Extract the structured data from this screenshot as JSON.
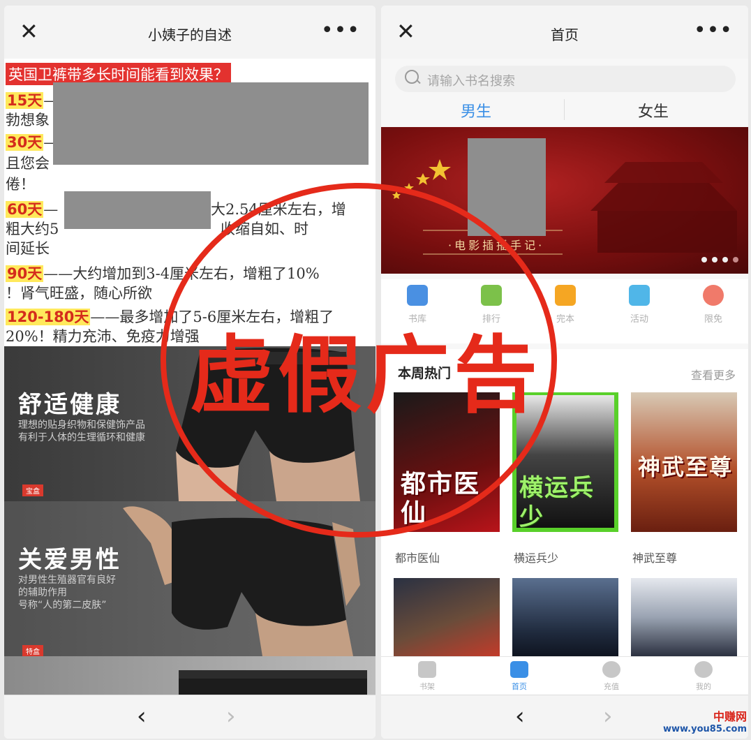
{
  "left_screen": {
    "title": "小姨子的自述",
    "close_icon": "close-icon",
    "more_icon": "more-icon",
    "article": {
      "headline": "英国卫裤带多长时间能看到效果？",
      "items": [
        {
          "day": "15天",
          "text": "—",
          "extra": "勃想象"
        },
        {
          "day": "30天",
          "text": "—",
          "extra": "且您会",
          "extra2": "倦！"
        },
        {
          "day": "60天",
          "text": "—",
          "tail": "大2.54厘米左右，增",
          "line2": "粗大约5",
          "line2b": "收缩自如、时",
          "line3": "间延长"
        },
        {
          "day": "90天",
          "text": "——大约增加到3-4厘米左右，增粗了10%",
          "line2": "！肾气旺盛，随心所欲"
        },
        {
          "day": "120-180天",
          "text": "——最多增加了5-6厘米左右，增粗了",
          "line2": "20%！精力充沛、免疫力增强"
        }
      ]
    },
    "ads": [
      {
        "heading": "舒适健康",
        "desc": [
          "理想的贴身织物和保健饰产品",
          "有利于人体的生理循环和健康"
        ],
        "tag": "宝盒"
      },
      {
        "heading": "关爱男性",
        "desc": [
          "对男性生殖器官有良好",
          "的辅助作用",
          "号称“人的第二皮肤”"
        ],
        "tag": "特盒"
      }
    ],
    "nav": {
      "back": "‹",
      "forward": "›"
    }
  },
  "right_screen": {
    "title": "首页",
    "search_placeholder": "请输入书名搜索",
    "gender_tabs": [
      "男生",
      "女生"
    ],
    "banner_caption": "·电影插播手记·",
    "banner_dots": 4,
    "categories": [
      {
        "label": "书库",
        "icon": "library-icon",
        "color": "#4a90e2"
      },
      {
        "label": "排行",
        "icon": "ranking-icon",
        "color": "#7cc14a"
      },
      {
        "label": "完本",
        "icon": "complete-icon",
        "color": "#f5a623"
      },
      {
        "label": "活动",
        "icon": "gift-icon",
        "color": "#50b6e8"
      },
      {
        "label": "限免",
        "icon": "clock-icon",
        "color": "#f07a6a"
      }
    ],
    "section_title": "本周热门",
    "section_more": "查看更多",
    "books": [
      {
        "name": "都市医仙",
        "cover_title": "都市医仙"
      },
      {
        "name": "横运兵少",
        "cover_title": "横运兵少"
      },
      {
        "name": "神武至尊",
        "cover_title": "神武至尊"
      }
    ],
    "tabbar": [
      {
        "label": "书架",
        "icon": "bookshelf-icon"
      },
      {
        "label": "首页",
        "icon": "home-icon"
      },
      {
        "label": "充值",
        "icon": "recharge-icon"
      },
      {
        "label": "我的",
        "icon": "profile-icon"
      }
    ],
    "nav": {
      "back": "‹",
      "forward": "›"
    }
  },
  "stamp": {
    "text": "虚假广告",
    "color": "#e52a1a"
  },
  "watermark": {
    "cn": "中赚网",
    "url": "www.you85.com"
  }
}
